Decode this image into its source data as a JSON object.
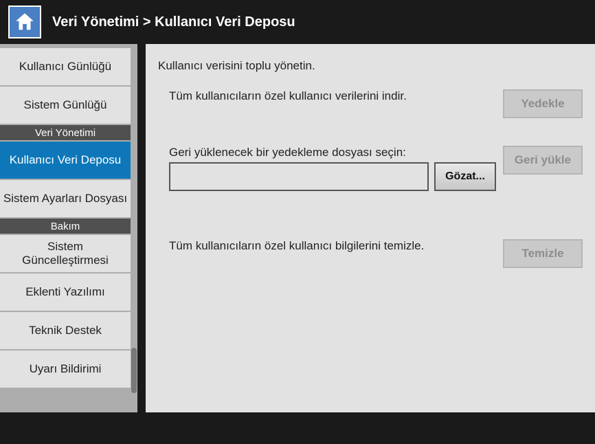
{
  "header": {
    "breadcrumb": "Veri Yönetimi  >  Kullanıcı Veri Deposu"
  },
  "sidebar": {
    "items": [
      {
        "type": "item",
        "label": "Kullanıcı Günlüğü",
        "active": false
      },
      {
        "type": "item",
        "label": "Sistem Günlüğü",
        "active": false
      },
      {
        "type": "section",
        "label": "Veri Yönetimi"
      },
      {
        "type": "item",
        "label": "Kullanıcı Veri Deposu",
        "active": true
      },
      {
        "type": "item",
        "label": "Sistem Ayarları Dosyası",
        "active": false
      },
      {
        "type": "section",
        "label": "Bakım"
      },
      {
        "type": "item",
        "label": "Sistem Güncelleştirmesi",
        "active": false
      },
      {
        "type": "item",
        "label": "Eklenti Yazılımı",
        "active": false
      },
      {
        "type": "item",
        "label": "Teknik Destek",
        "active": false
      },
      {
        "type": "item",
        "label": "Uyarı Bildirimi",
        "active": false
      }
    ]
  },
  "content": {
    "intro": "Kullanıcı verisini toplu yönetin.",
    "backup": {
      "text": "Tüm kullanıcıların özel kullanıcı verilerini indir.",
      "button": "Yedekle"
    },
    "restore": {
      "label": "Geri yüklenecek bir yedekleme dosyası seçin:",
      "value": "",
      "browse": "Gözat...",
      "button": "Geri yükle"
    },
    "clear": {
      "text": "Tüm kullanıcıların özel kullanıcı bilgilerini temizle.",
      "button": "Temizle"
    }
  }
}
